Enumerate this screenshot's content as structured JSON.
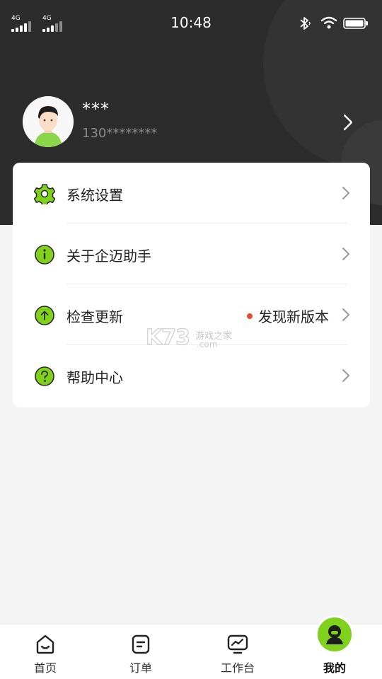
{
  "status_bar": {
    "sim1_label": "4G",
    "sim2_label": "4G",
    "time": "10:48",
    "bluetooth_icon": "bluetooth-icon",
    "wifi_icon": "wifi-icon",
    "battery_icon": "battery-icon"
  },
  "profile": {
    "name": "***",
    "phone": "130********"
  },
  "menu": {
    "items": [
      {
        "label": "系统设置",
        "icon": "settings-gear-icon"
      },
      {
        "label": "关于企迈助手",
        "icon": "info-icon"
      },
      {
        "label": "检查更新",
        "icon": "upload-arrow-icon",
        "badge": "发现新版本"
      },
      {
        "label": "帮助中心",
        "icon": "help-question-icon"
      }
    ]
  },
  "watermark": {
    "logo": "K73",
    "text": "游戏之家",
    "domain": ".com"
  },
  "tabbar": {
    "tabs": [
      {
        "label": "首页",
        "icon": "home-icon"
      },
      {
        "label": "订单",
        "icon": "order-icon"
      },
      {
        "label": "工作台",
        "icon": "workbench-monitor-icon"
      },
      {
        "label": "我的",
        "icon": "profile-avatar-icon",
        "active": true
      }
    ]
  },
  "colors": {
    "accent_green": "#7fd11b",
    "header_bg": "#2c2c2c",
    "badge_red": "#e8492f"
  }
}
